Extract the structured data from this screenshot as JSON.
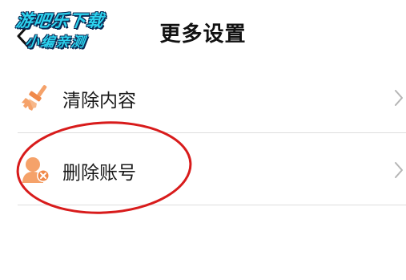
{
  "header": {
    "title": "更多设置",
    "back_icon": "chevron-left-icon"
  },
  "watermark": {
    "line1": "游吧乐下载",
    "line2": "小编亲测",
    "color": "#2dd3ee"
  },
  "settings": {
    "items": [
      {
        "label": "清除内容",
        "icon": "broom-icon",
        "chevron": "chevron-right-icon"
      },
      {
        "label": "删除账号",
        "icon": "delete-user-icon",
        "chevron": "chevron-right-icon"
      }
    ]
  },
  "colors": {
    "icon_accent": "#f5a26a",
    "annotation": "#d81b1b",
    "divider": "#dddddd"
  }
}
